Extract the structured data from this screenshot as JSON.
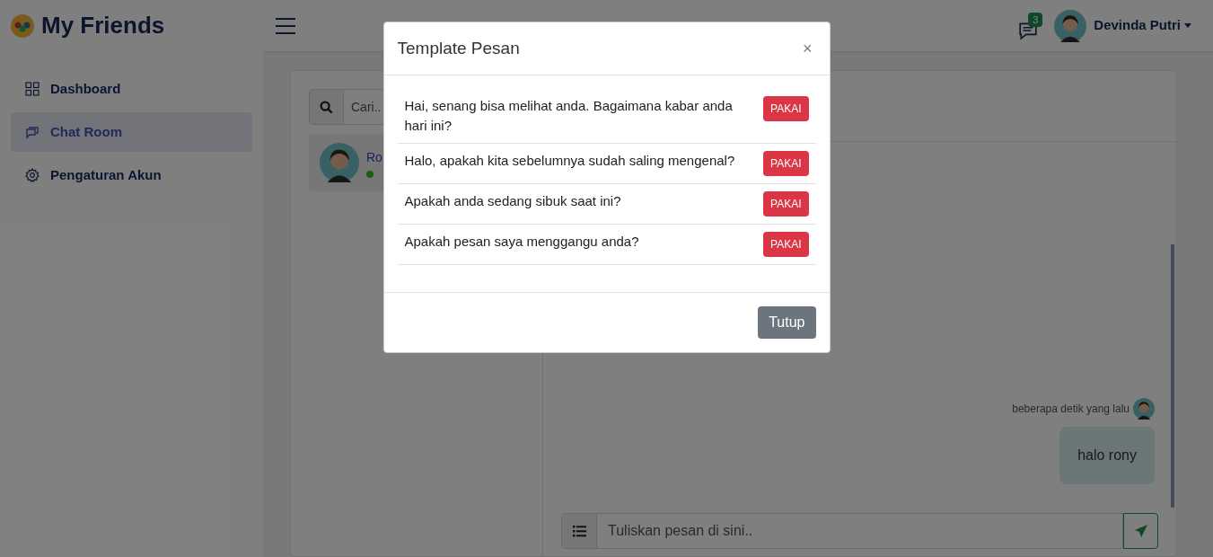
{
  "header": {
    "brand": "My Friends",
    "messages_badge": "3",
    "user_name": "Devinda Putri"
  },
  "sidebar": {
    "items": [
      {
        "label": "Dashboard",
        "kind": "grid",
        "selected": false
      },
      {
        "label": "Chat Room",
        "kind": "chat",
        "selected": true
      },
      {
        "label": "Pengaturan Akun",
        "kind": "gear",
        "selected": false
      }
    ]
  },
  "contacts": {
    "search_placeholder": "Cari..",
    "items": [
      {
        "name": "Ro",
        "online": true
      }
    ]
  },
  "chat": {
    "messages": [
      {
        "time": "beberapa detik yang lalu",
        "text": "halo rony",
        "outgoing": true
      }
    ],
    "input_placeholder": "Tuliskan pesan di sini.."
  },
  "modal": {
    "title": "Template Pesan",
    "close_symbol": "×",
    "templates": [
      {
        "text": "Hai, senang bisa melihat anda. Bagaimana kabar anda hari ini?",
        "button": "PAKAI"
      },
      {
        "text": "Halo, apakah kita sebelumnya sudah saling mengenal?",
        "button": "PAKAI"
      },
      {
        "text": "Apakah anda sedang sibuk saat ini?",
        "button": "PAKAI"
      },
      {
        "text": "Apakah pesan saya menggangu anda?",
        "button": "PAKAI"
      }
    ],
    "close_button": "Tutup"
  }
}
